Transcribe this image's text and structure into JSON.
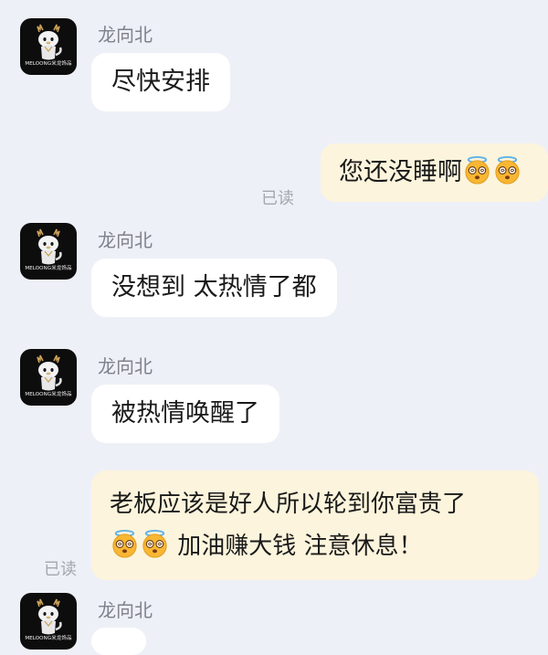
{
  "chat": {
    "messages": [
      {
        "sender": "龙向北",
        "text": "尽快安排",
        "direction": "incoming"
      },
      {
        "text": "您还没睡啊",
        "emoji": [
          "dizzy-halo-face",
          "dizzy-halo-face"
        ],
        "direction": "outgoing",
        "read_label": "已读"
      },
      {
        "sender": "龙向北",
        "text": "没想到 太热情了都",
        "direction": "incoming"
      },
      {
        "sender": "龙向北",
        "text": "被热情唤醒了",
        "direction": "incoming"
      },
      {
        "line1": "老板应该是好人所以轮到你富贵了",
        "emoji": [
          "dizzy-halo-face",
          "dizzy-halo-face"
        ],
        "line2": " 加油赚大钱 注意休息！",
        "direction": "outgoing",
        "read_label": "已读"
      },
      {
        "sender": "龙向北",
        "direction": "incoming"
      }
    ],
    "avatar_brand": "MELOONG米龙饰品"
  },
  "colors": {
    "background": "#eef0f7",
    "incoming_bubble": "#ffffff",
    "outgoing_bubble": "#fcf4dc",
    "sender_name": "#7f828b",
    "read_receipt": "#a4a7ae"
  }
}
